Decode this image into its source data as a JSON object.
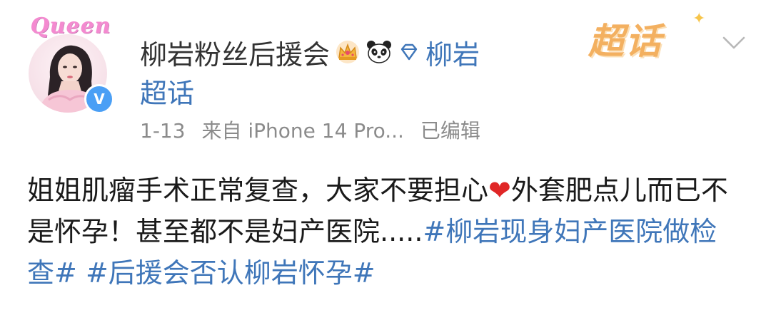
{
  "post": {
    "author": {
      "name": "柳岩粉丝后援会",
      "avatar_badge_text": "Queen",
      "verified_mark": "V",
      "badges": [
        "crown-icon",
        "panda-icon"
      ]
    },
    "topic": {
      "name_line1": "柳岩",
      "name_line2": "超话"
    },
    "meta": {
      "date": "1-13",
      "source": "来自 iPhone 14 Pro...",
      "edited": "已编辑"
    },
    "supertopic_label": "超话",
    "content": {
      "text_part1": "姐姐肌瘤手术正常复查，大家不要担心",
      "heart": "❤",
      "text_part2": "外套肥点儿而已不是怀孕！甚至都不是妇产医院.....",
      "hashtag1": "#柳岩现身妇产医院做检查#",
      "hashtag2": "#后援会否认柳岩怀孕#"
    },
    "colors": {
      "link": "#3f76b9",
      "meta": "#8b8b8b",
      "supertopic": "#f3b060",
      "verified": "#4a9ff5"
    }
  }
}
